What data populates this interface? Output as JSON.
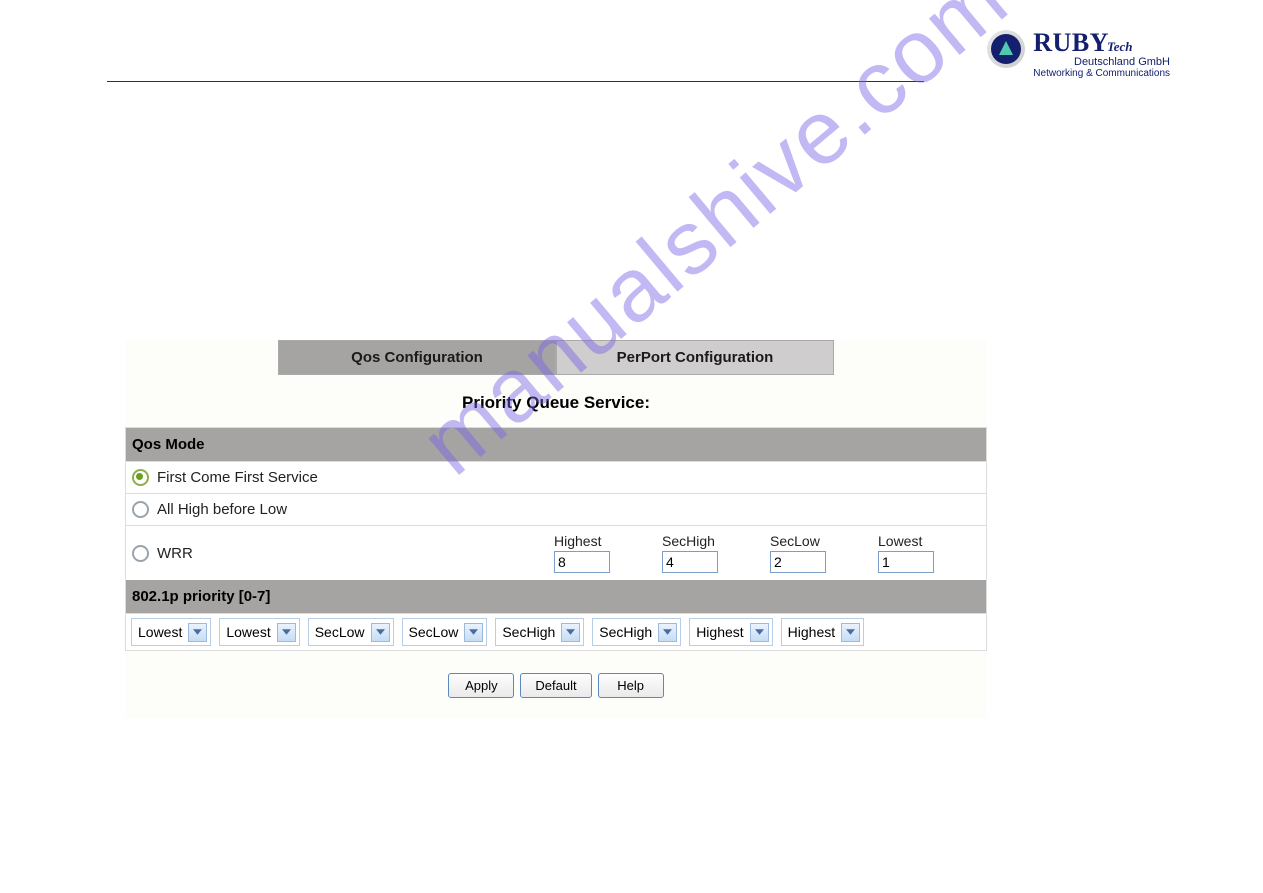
{
  "brand": {
    "main": "RUBY",
    "tech": "Tech",
    "sub1": "Deutschland GmbH",
    "sub2": "Networking & Communications"
  },
  "watermark": "manualshive.com",
  "tabs": [
    {
      "label": "Qos Configuration"
    },
    {
      "label": "PerPort Configuration"
    }
  ],
  "section_title": "Priority Queue Service:",
  "qos_mode_header": "Qos Mode",
  "mode_options": {
    "fcfs": "First Come First Service",
    "ahbl": "All High before Low",
    "wrr": "WRR"
  },
  "wrr": {
    "highest": {
      "label": "Highest",
      "value": "8"
    },
    "sechigh": {
      "label": "SecHigh",
      "value": "4"
    },
    "seclow": {
      "label": "SecLow",
      "value": "2"
    },
    "lowest": {
      "label": "Lowest",
      "value": "1"
    }
  },
  "priority_header": "802.1p priority [0-7]",
  "priority_selects": [
    "Lowest",
    "Lowest",
    "SecLow",
    "SecLow",
    "SecHigh",
    "SecHigh",
    "Highest",
    "Highest"
  ],
  "buttons": {
    "apply": "Apply",
    "default": "Default",
    "help": "Help"
  }
}
